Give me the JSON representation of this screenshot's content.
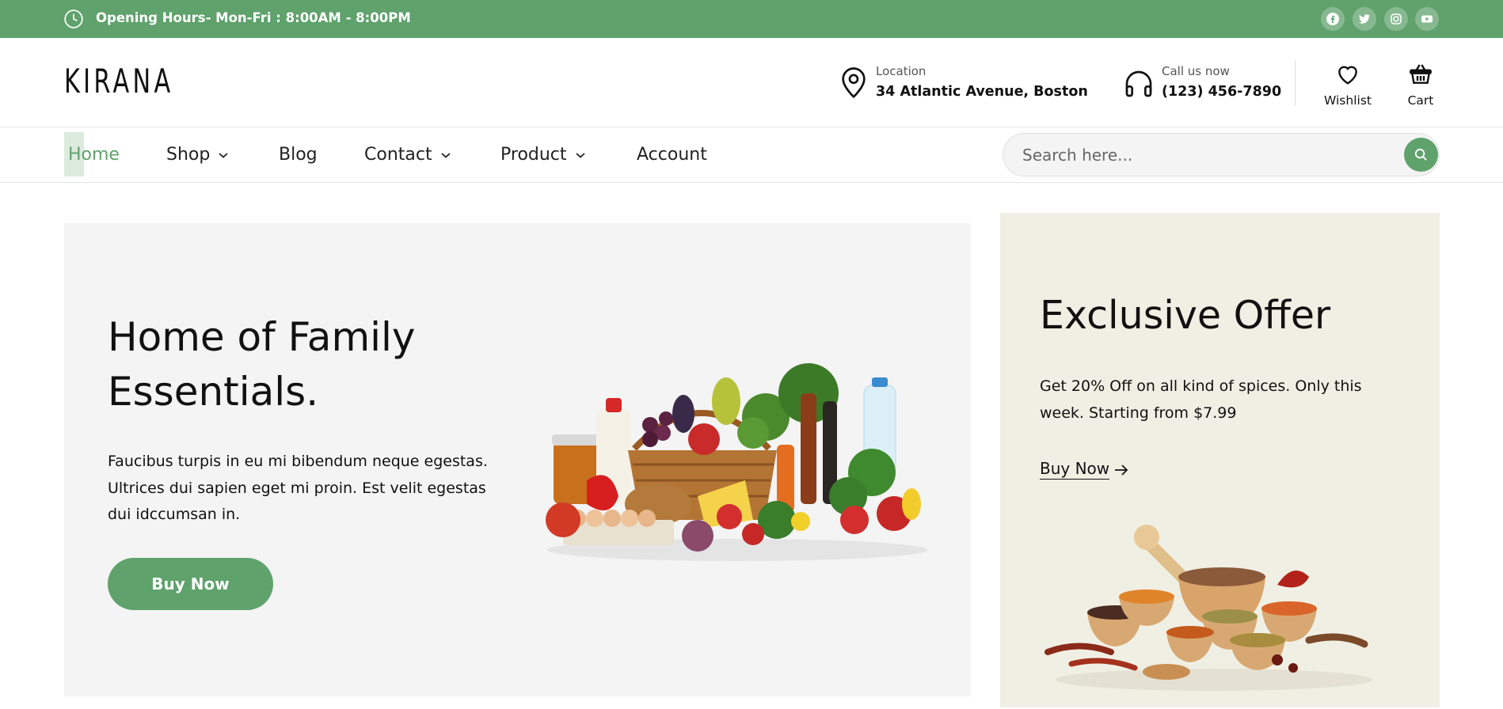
{
  "topbar": {
    "hours": "Opening Hours- Mon-Fri : 8:00AM - 8:00PM",
    "socials": [
      "facebook-icon",
      "twitter-icon",
      "instagram-icon",
      "youtube-icon"
    ]
  },
  "header": {
    "logo": "KIRANA",
    "location": {
      "label": "Location",
      "value": "34 Atlantic Avenue, Boston"
    },
    "phone": {
      "label": "Call us now",
      "value": "(123) 456-7890"
    },
    "wishlist_label": "Wishlist",
    "cart_label": "Cart"
  },
  "nav": {
    "items": [
      {
        "label": "Home",
        "active": true
      },
      {
        "label": "Shop",
        "dropdown": true
      },
      {
        "label": "Blog"
      },
      {
        "label": "Contact",
        "dropdown": true
      },
      {
        "label": "Product",
        "dropdown": true
      },
      {
        "label": "Account"
      }
    ],
    "search_placeholder": "Search here..."
  },
  "hero": {
    "title": "Home of Family Essentials.",
    "text": "Faucibus turpis in eu mi bibendum neque egestas. Ultrices dui sapien eget mi proin. Est velit egestas dui idccumsan in.",
    "button": "Buy Now"
  },
  "offer": {
    "title": "Exclusive Offer",
    "text": "Get 20% Off on all kind of spices. Only this week. Starting from $7.99",
    "button": "Buy Now"
  },
  "colors": {
    "accent": "#5fa26c",
    "hero_bg": "#f4f4f4",
    "offer_bg": "#f0efe4"
  }
}
